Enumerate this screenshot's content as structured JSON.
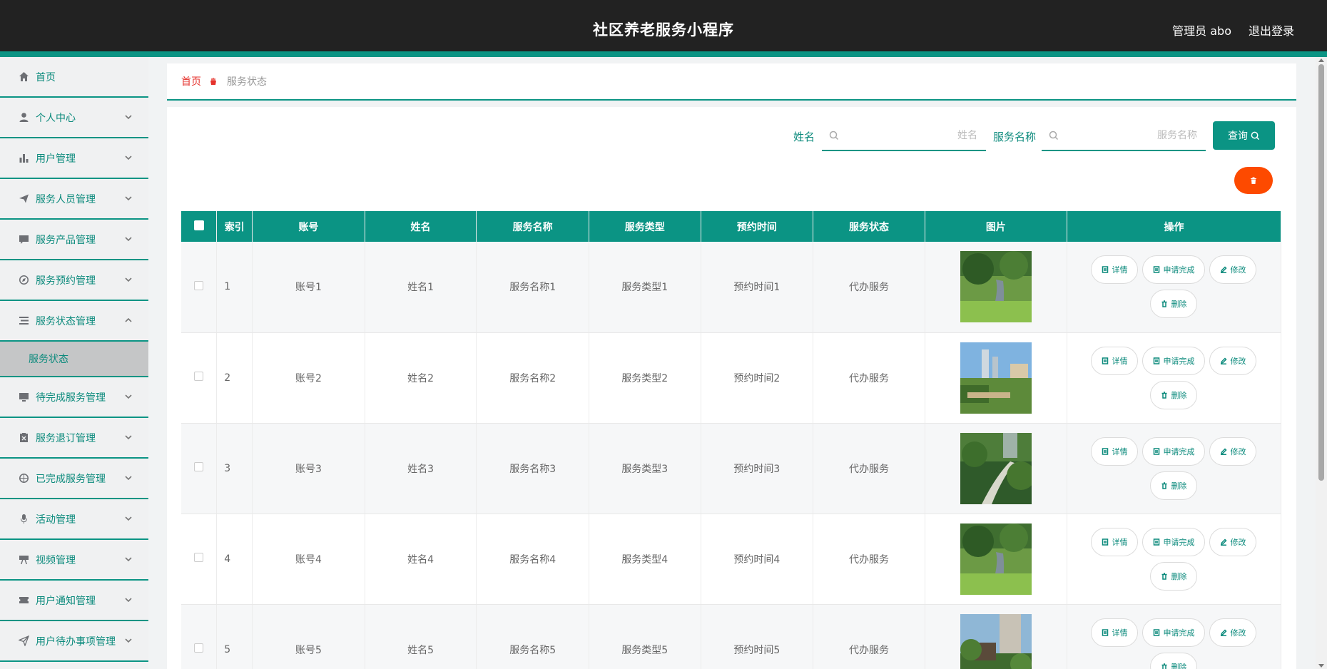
{
  "header": {
    "title": "社区养老服务小程序",
    "user": "管理员 abo",
    "logout": "退出登录"
  },
  "sidebar": {
    "items": [
      {
        "label": "首页",
        "icon": "home-icon",
        "chevron": false
      },
      {
        "label": "个人中心",
        "icon": "user-icon",
        "chevron": true
      },
      {
        "label": "用户管理",
        "icon": "bar-chart-icon",
        "chevron": true
      },
      {
        "label": "服务人员管理",
        "icon": "send-icon",
        "chevron": true
      },
      {
        "label": "服务产品管理",
        "icon": "chat-icon",
        "chevron": true
      },
      {
        "label": "服务预约管理",
        "icon": "compass-icon",
        "chevron": true
      },
      {
        "label": "服务状态管理",
        "icon": "list-icon",
        "chevron": true,
        "expanded": true
      },
      {
        "label": "待完成服务管理",
        "icon": "monitor-icon",
        "chevron": true
      },
      {
        "label": "服务退订管理",
        "icon": "clipboard-icon",
        "chevron": true
      },
      {
        "label": "已完成服务管理",
        "icon": "target-icon",
        "chevron": true
      },
      {
        "label": "活动管理",
        "icon": "mic-icon",
        "chevron": true
      },
      {
        "label": "视频管理",
        "icon": "projector-icon",
        "chevron": true
      },
      {
        "label": "用户通知管理",
        "icon": "ticket-icon",
        "chevron": true
      },
      {
        "label": "用户待办事项管理",
        "icon": "paper-plane-icon",
        "chevron": true
      }
    ],
    "sub_item": "服务状态"
  },
  "breadcrumb": {
    "home": "首页",
    "current": "服务状态"
  },
  "search": {
    "name_label": "姓名",
    "name_placeholder": "姓名",
    "service_label": "服务名称",
    "service_placeholder": "服务名称",
    "query_button": "查询"
  },
  "table": {
    "columns": [
      "索引",
      "账号",
      "姓名",
      "服务名称",
      "服务类型",
      "预约时间",
      "服务状态",
      "图片",
      "操作"
    ],
    "rows": [
      {
        "index": "1",
        "account": "账号1",
        "name": "姓名1",
        "service": "服务名称1",
        "type": "服务类型1",
        "time": "预约时间1",
        "status": "代办服务",
        "img": "garden"
      },
      {
        "index": "2",
        "account": "账号2",
        "name": "姓名2",
        "service": "服务名称2",
        "type": "服务类型2",
        "time": "预约时间2",
        "status": "代办服务",
        "img": "city"
      },
      {
        "index": "3",
        "account": "账号3",
        "name": "姓名3",
        "service": "服务名称3",
        "type": "服务类型3",
        "time": "预约时间3",
        "status": "代办服务",
        "img": "path"
      },
      {
        "index": "4",
        "account": "账号4",
        "name": "姓名4",
        "service": "服务名称4",
        "type": "服务类型4",
        "time": "预约时间4",
        "status": "代办服务",
        "img": "garden"
      },
      {
        "index": "5",
        "account": "账号5",
        "name": "姓名5",
        "service": "服务名称5",
        "type": "服务类型5",
        "time": "预约时间5",
        "status": "代办服务",
        "img": "tower"
      }
    ],
    "actions": {
      "detail": "详情",
      "apply": "申请完成",
      "edit": "修改",
      "delete": "删除"
    }
  },
  "colors": {
    "accent": "#0b9484",
    "danger": "#fd4a00",
    "header_bg": "#222222"
  }
}
